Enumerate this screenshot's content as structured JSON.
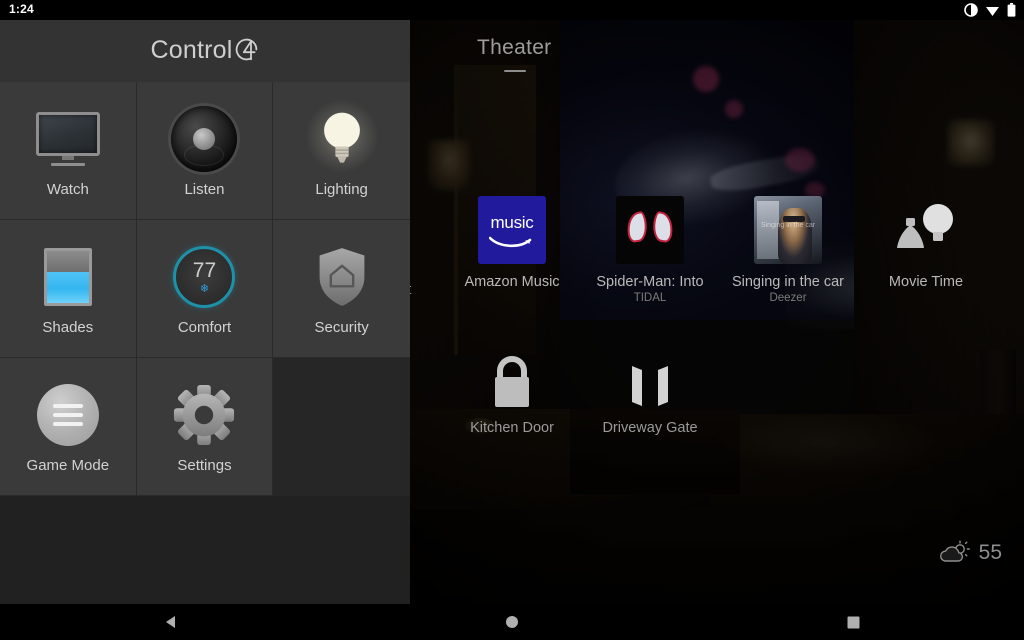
{
  "statusbar": {
    "clock": "1:24",
    "icons": [
      "dnd-icon",
      "wifi-icon",
      "battery-icon"
    ]
  },
  "left_panel": {
    "brand": "Control",
    "brand_mark": "4",
    "tiles": [
      {
        "label": "Watch",
        "icon": "television-icon"
      },
      {
        "label": "Listen",
        "icon": "speaker-icon"
      },
      {
        "label": "Lighting",
        "icon": "lightbulb-icon"
      },
      {
        "label": "Shades",
        "icon": "window-shade-icon"
      },
      {
        "label": "Comfort",
        "icon": "thermostat-icon",
        "value": "77",
        "mode_icon": "snowflake-icon"
      },
      {
        "label": "Security",
        "icon": "shield-home-icon"
      },
      {
        "label": "Game Mode",
        "icon": "hamburger-circle-icon"
      },
      {
        "label": "Settings",
        "icon": "gear-icon"
      }
    ]
  },
  "right_panel": {
    "room_title": "Theater",
    "clipped_label": "ect",
    "media": [
      {
        "label": "Amazon Music",
        "sub": "",
        "art": "amazon-music-art",
        "art_text": "music"
      },
      {
        "label": "Spider-Man: Into",
        "sub": "TIDAL",
        "art": "spider-man-art"
      },
      {
        "label": "Singing in the car",
        "sub": "Deezer",
        "art": "deezer-art",
        "art_text": "Singing in the car"
      },
      {
        "label": "Movie Time",
        "sub": "",
        "art": "light-scene-icon"
      }
    ],
    "locks": [
      {
        "label": "Kitchen Door",
        "icon": "padlock-icon"
      },
      {
        "label": "Driveway Gate",
        "icon": "gate-icon"
      }
    ],
    "weather": {
      "icon": "sun-behind-cloud-icon",
      "temperature": "55"
    }
  },
  "navbar": {
    "buttons": [
      {
        "name": "back-button",
        "icon": "triangle-left-icon"
      },
      {
        "name": "home-button",
        "icon": "circle-icon"
      },
      {
        "name": "recents-button",
        "icon": "square-icon"
      }
    ]
  },
  "colors": {
    "accent_teal": "#1e90a8",
    "shade_blue": "#4fc3f7",
    "amazon_blue": "#211a9c",
    "spider_red": "#c4223f",
    "panel_bg": "#1e1e1e",
    "tile_bg": "#3a3a3a",
    "header_bg": "#333333"
  }
}
